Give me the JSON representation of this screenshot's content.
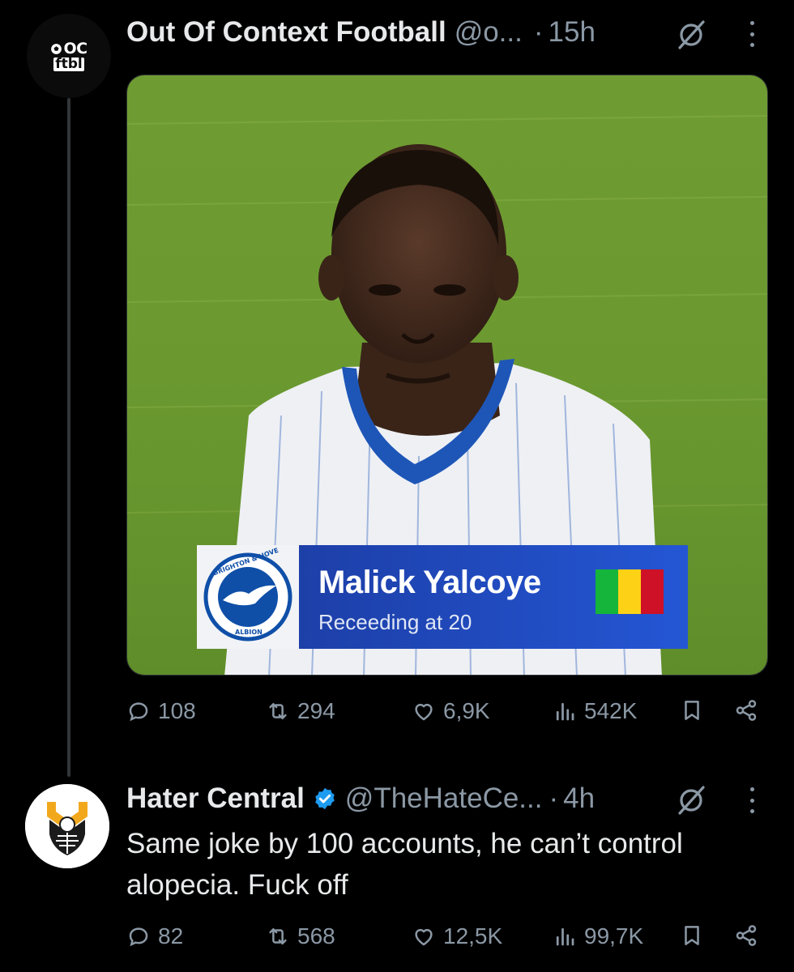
{
  "tweets": [
    {
      "display_name": "Out Of Context Football",
      "handle": "@o...",
      "separator": "·",
      "time": "15h",
      "avatar": {
        "line1": "OC",
        "line2": "ftbl",
        "icon": "football-icon"
      },
      "media": {
        "lower_third": {
          "player_name": "Malick Yalcoye",
          "caption": "Receeding at 20",
          "crest_top": "BRIGHTON & HOVE",
          "crest_bottom": "ALBION",
          "flag_colors": [
            "#14b53a",
            "#fcd116",
            "#ce1126"
          ]
        }
      },
      "stats": {
        "replies": "108",
        "retweets": "294",
        "likes": "6,9K",
        "views": "542K"
      }
    },
    {
      "display_name": "Hater Central",
      "handle": "@TheHateCe...",
      "separator": "·",
      "time": "4h",
      "verified": true,
      "text": "Same joke by 100 accounts, he can’t control alopecia. Fuck off",
      "stats": {
        "replies": "82",
        "retweets": "568",
        "likes": "12,5K",
        "views": "99,7K"
      }
    }
  ],
  "colors": {
    "background": "#000000",
    "text_primary": "#e7e9ea",
    "text_secondary": "#8b98a5",
    "verified_blue": "#1d9bf0",
    "thread_line": "#333639"
  }
}
